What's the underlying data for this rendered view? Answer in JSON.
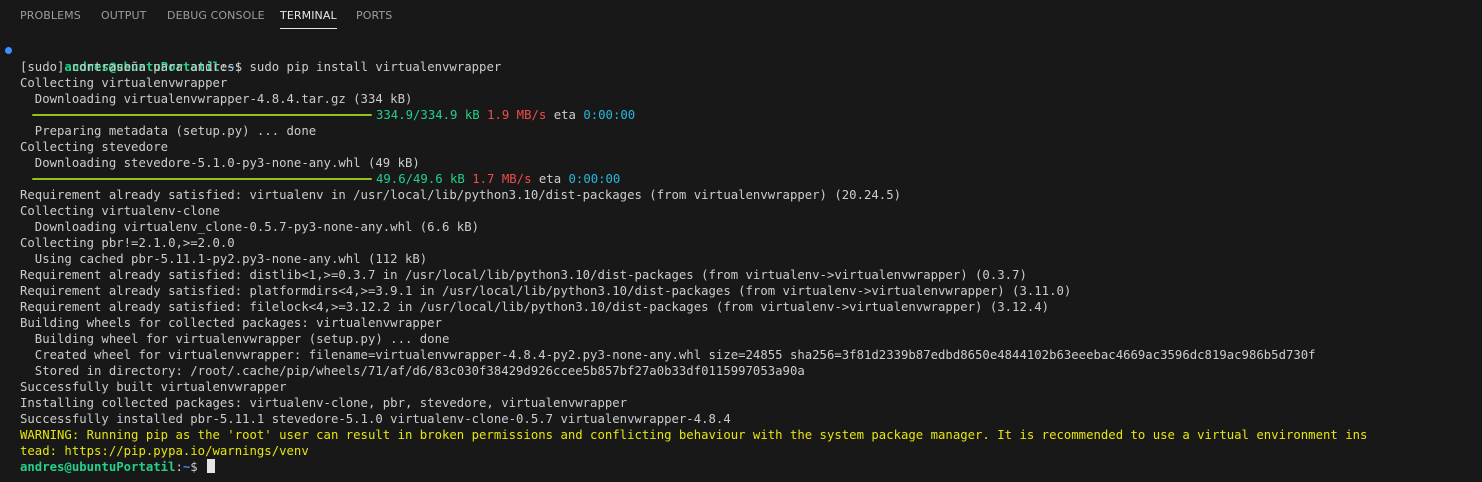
{
  "tabs": {
    "problems": "PROBLEMS",
    "output": "OUTPUT",
    "debug_console": "DEBUG CONSOLE",
    "terminal": "TERMINAL",
    "ports": "PORTS"
  },
  "prompt": {
    "user": "andres@ubuntuPortatil",
    "sep": ":",
    "path": "~",
    "symbol": "$ "
  },
  "lines": {
    "cmd": "sudo pip install virtualenvwrapper",
    "l02": "[sudo] contraseña para andres:",
    "l03": "Collecting virtualenvwrapper",
    "l04": "  Downloading virtualenvwrapper-4.8.4.tar.gz (334 kB)",
    "l06": "  Preparing metadata (setup.py) ... done",
    "l07": "Collecting stevedore",
    "l08": "  Downloading stevedore-5.1.0-py3-none-any.whl (49 kB)",
    "l10": "Requirement already satisfied: virtualenv in /usr/local/lib/python3.10/dist-packages (from virtualenvwrapper) (20.24.5)",
    "l11": "Collecting virtualenv-clone",
    "l12": "  Downloading virtualenv_clone-0.5.7-py3-none-any.whl (6.6 kB)",
    "l13": "Collecting pbr!=2.1.0,>=2.0.0",
    "l14": "  Using cached pbr-5.11.1-py2.py3-none-any.whl (112 kB)",
    "l15": "Requirement already satisfied: distlib<1,>=0.3.7 in /usr/local/lib/python3.10/dist-packages (from virtualenv->virtualenvwrapper) (0.3.7)",
    "l16": "Requirement already satisfied: platformdirs<4,>=3.9.1 in /usr/local/lib/python3.10/dist-packages (from virtualenv->virtualenvwrapper) (3.11.0)",
    "l17": "Requirement already satisfied: filelock<4,>=3.12.2 in /usr/local/lib/python3.10/dist-packages (from virtualenv->virtualenvwrapper) (3.12.4)",
    "l18": "Building wheels for collected packages: virtualenvwrapper",
    "l19": "  Building wheel for virtualenvwrapper (setup.py) ... done",
    "l20": "  Created wheel for virtualenvwrapper: filename=virtualenvwrapper-4.8.4-py2.py3-none-any.whl size=24855 sha256=3f81d2339b87edbd8650e4844102b63eeebac4669ac3596dc819ac986b5d730f",
    "l21": "  Stored in directory: /root/.cache/pip/wheels/71/af/d6/83c030f38429d926ccee5b857bf27a0b33df0115997053a90a",
    "l22": "Successfully built virtualenvwrapper",
    "l23": "Installing collected packages: virtualenv-clone, pbr, stevedore, virtualenvwrapper",
    "l24": "Successfully installed pbr-5.11.1 stevedore-5.1.0 virtualenv-clone-0.5.7 virtualenvwrapper-4.8.4",
    "l25": "WARNING: Running pip as the 'root' user can result in broken permissions and conflicting behaviour with the system package manager. It is recommended to use a virtual environment ins",
    "l26": "tead: https://pip.pypa.io/warnings/venv"
  },
  "progress1": {
    "fraction": 1.0,
    "size": "334.9/334.9 kB",
    "speed": "1.9 MB/s",
    "eta_label": "eta",
    "eta": "0:00:00"
  },
  "progress2": {
    "fraction": 1.0,
    "size": "49.6/49.6 kB",
    "speed": "1.7 MB/s",
    "eta_label": "eta",
    "eta": "0:00:00"
  },
  "colors": {
    "background": "#181818",
    "prompt_user": "#23d18b",
    "prompt_path": "#3b8eea",
    "progress_bar": "#94c11f",
    "size_text": "#23d18b",
    "speed_text": "#f14c4c",
    "eta_time": "#29b8db",
    "warning": "#e5e510",
    "command_dot": "#3794ff"
  }
}
